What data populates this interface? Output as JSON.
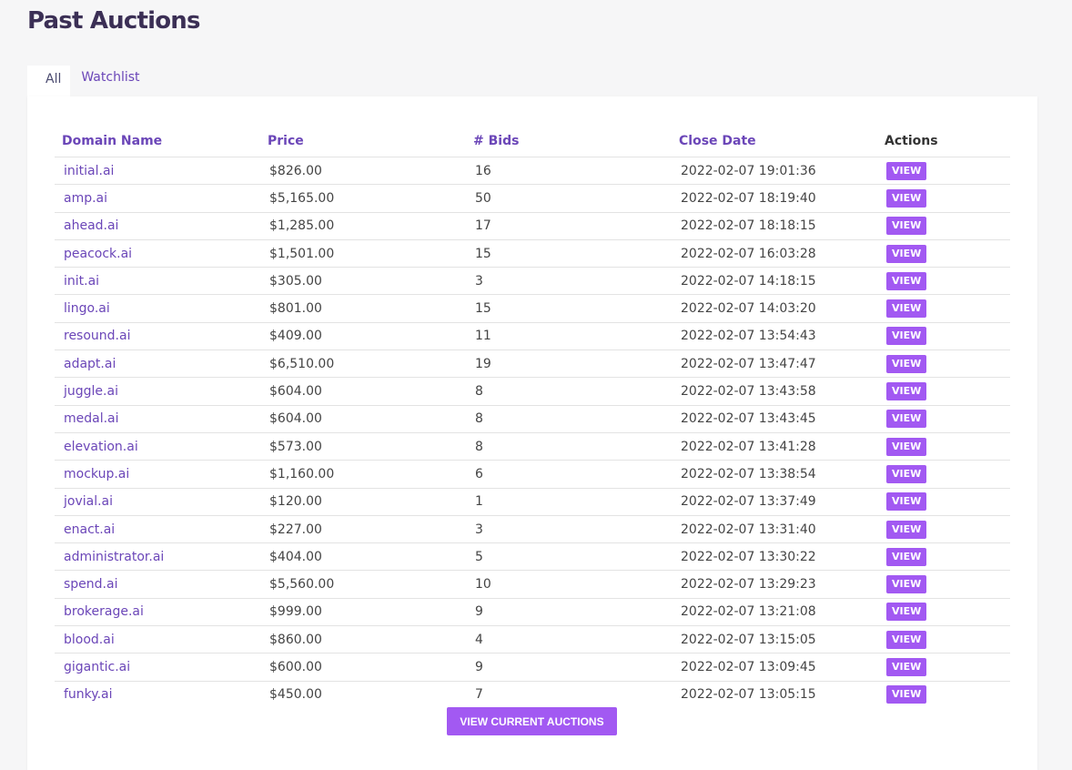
{
  "page": {
    "title": "Past Auctions",
    "tabs": [
      {
        "label": "All",
        "active": true
      },
      {
        "label": "Watchlist",
        "active": false
      }
    ]
  },
  "table": {
    "headers": {
      "domain": "Domain Name",
      "price": "Price",
      "bids": "# Bids",
      "close_date": "Close Date",
      "actions": "Actions"
    },
    "view_label": "VIEW",
    "rows": [
      {
        "domain": "initial.ai",
        "price": "$826.00",
        "bids": "16",
        "close_date": "2022-02-07 19:01:36"
      },
      {
        "domain": "amp.ai",
        "price": "$5,165.00",
        "bids": "50",
        "close_date": "2022-02-07 18:19:40"
      },
      {
        "domain": "ahead.ai",
        "price": "$1,285.00",
        "bids": "17",
        "close_date": "2022-02-07 18:18:15"
      },
      {
        "domain": "peacock.ai",
        "price": "$1,501.00",
        "bids": "15",
        "close_date": "2022-02-07 16:03:28"
      },
      {
        "domain": "init.ai",
        "price": "$305.00",
        "bids": "3",
        "close_date": "2022-02-07 14:18:15"
      },
      {
        "domain": "lingo.ai",
        "price": "$801.00",
        "bids": "15",
        "close_date": "2022-02-07 14:03:20"
      },
      {
        "domain": "resound.ai",
        "price": "$409.00",
        "bids": "11",
        "close_date": "2022-02-07 13:54:43"
      },
      {
        "domain": "adapt.ai",
        "price": "$6,510.00",
        "bids": "19",
        "close_date": "2022-02-07 13:47:47"
      },
      {
        "domain": "juggle.ai",
        "price": "$604.00",
        "bids": "8",
        "close_date": "2022-02-07 13:43:58"
      },
      {
        "domain": "medal.ai",
        "price": "$604.00",
        "bids": "8",
        "close_date": "2022-02-07 13:43:45"
      },
      {
        "domain": "elevation.ai",
        "price": "$573.00",
        "bids": "8",
        "close_date": "2022-02-07 13:41:28"
      },
      {
        "domain": "mockup.ai",
        "price": "$1,160.00",
        "bids": "6",
        "close_date": "2022-02-07 13:38:54"
      },
      {
        "domain": "jovial.ai",
        "price": "$120.00",
        "bids": "1",
        "close_date": "2022-02-07 13:37:49"
      },
      {
        "domain": "enact.ai",
        "price": "$227.00",
        "bids": "3",
        "close_date": "2022-02-07 13:31:40"
      },
      {
        "domain": "administrator.ai",
        "price": "$404.00",
        "bids": "5",
        "close_date": "2022-02-07 13:30:22"
      },
      {
        "domain": "spend.ai",
        "price": "$5,560.00",
        "bids": "10",
        "close_date": "2022-02-07 13:29:23"
      },
      {
        "domain": "brokerage.ai",
        "price": "$999.00",
        "bids": "9",
        "close_date": "2022-02-07 13:21:08"
      },
      {
        "domain": "blood.ai",
        "price": "$860.00",
        "bids": "4",
        "close_date": "2022-02-07 13:15:05"
      },
      {
        "domain": "gigantic.ai",
        "price": "$600.00",
        "bids": "9",
        "close_date": "2022-02-07 13:09:45"
      },
      {
        "domain": "funky.ai",
        "price": "$450.00",
        "bids": "7",
        "close_date": "2022-02-07 13:05:15"
      }
    ]
  },
  "footer": {
    "view_current_label": "VIEW CURRENT AUCTIONS"
  },
  "colors": {
    "accent": "#a259f2",
    "link": "#6b46b8",
    "title": "#3b2f55"
  }
}
